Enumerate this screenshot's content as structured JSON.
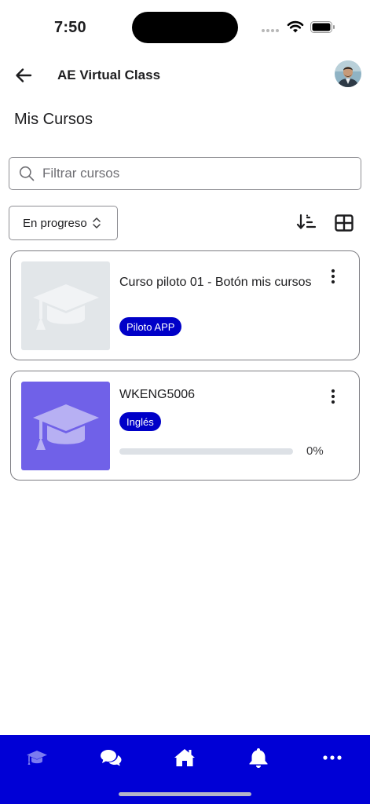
{
  "status_bar": {
    "time": "7:50"
  },
  "header": {
    "title": "AE Virtual Class"
  },
  "page": {
    "title": "Mis Cursos"
  },
  "search": {
    "placeholder": "Filtrar cursos",
    "value": ""
  },
  "filter": {
    "selected": "En progreso"
  },
  "courses": [
    {
      "name": "Curso piloto 01 - Botón mis cursos",
      "tag": "Piloto APP",
      "thumbnail_color": "#e2e6e9",
      "icon": "graduation-cap-icon"
    },
    {
      "name": "WKENG5006",
      "tag": "Inglés",
      "thumbnail_color": "#7061e8",
      "icon": "graduation-cap-icon",
      "progress_percent": 0,
      "progress_label": "0%"
    }
  ],
  "bottom_nav": {
    "items": [
      "graduation-cap-icon",
      "chat-bubbles-icon",
      "home-icon",
      "bell-icon",
      "more-horizontal-icon"
    ],
    "active": "graduation-cap-icon"
  },
  "colors": {
    "accent": "#0000c8",
    "nav_background": "#0000d6",
    "border": "#8e8e93"
  }
}
